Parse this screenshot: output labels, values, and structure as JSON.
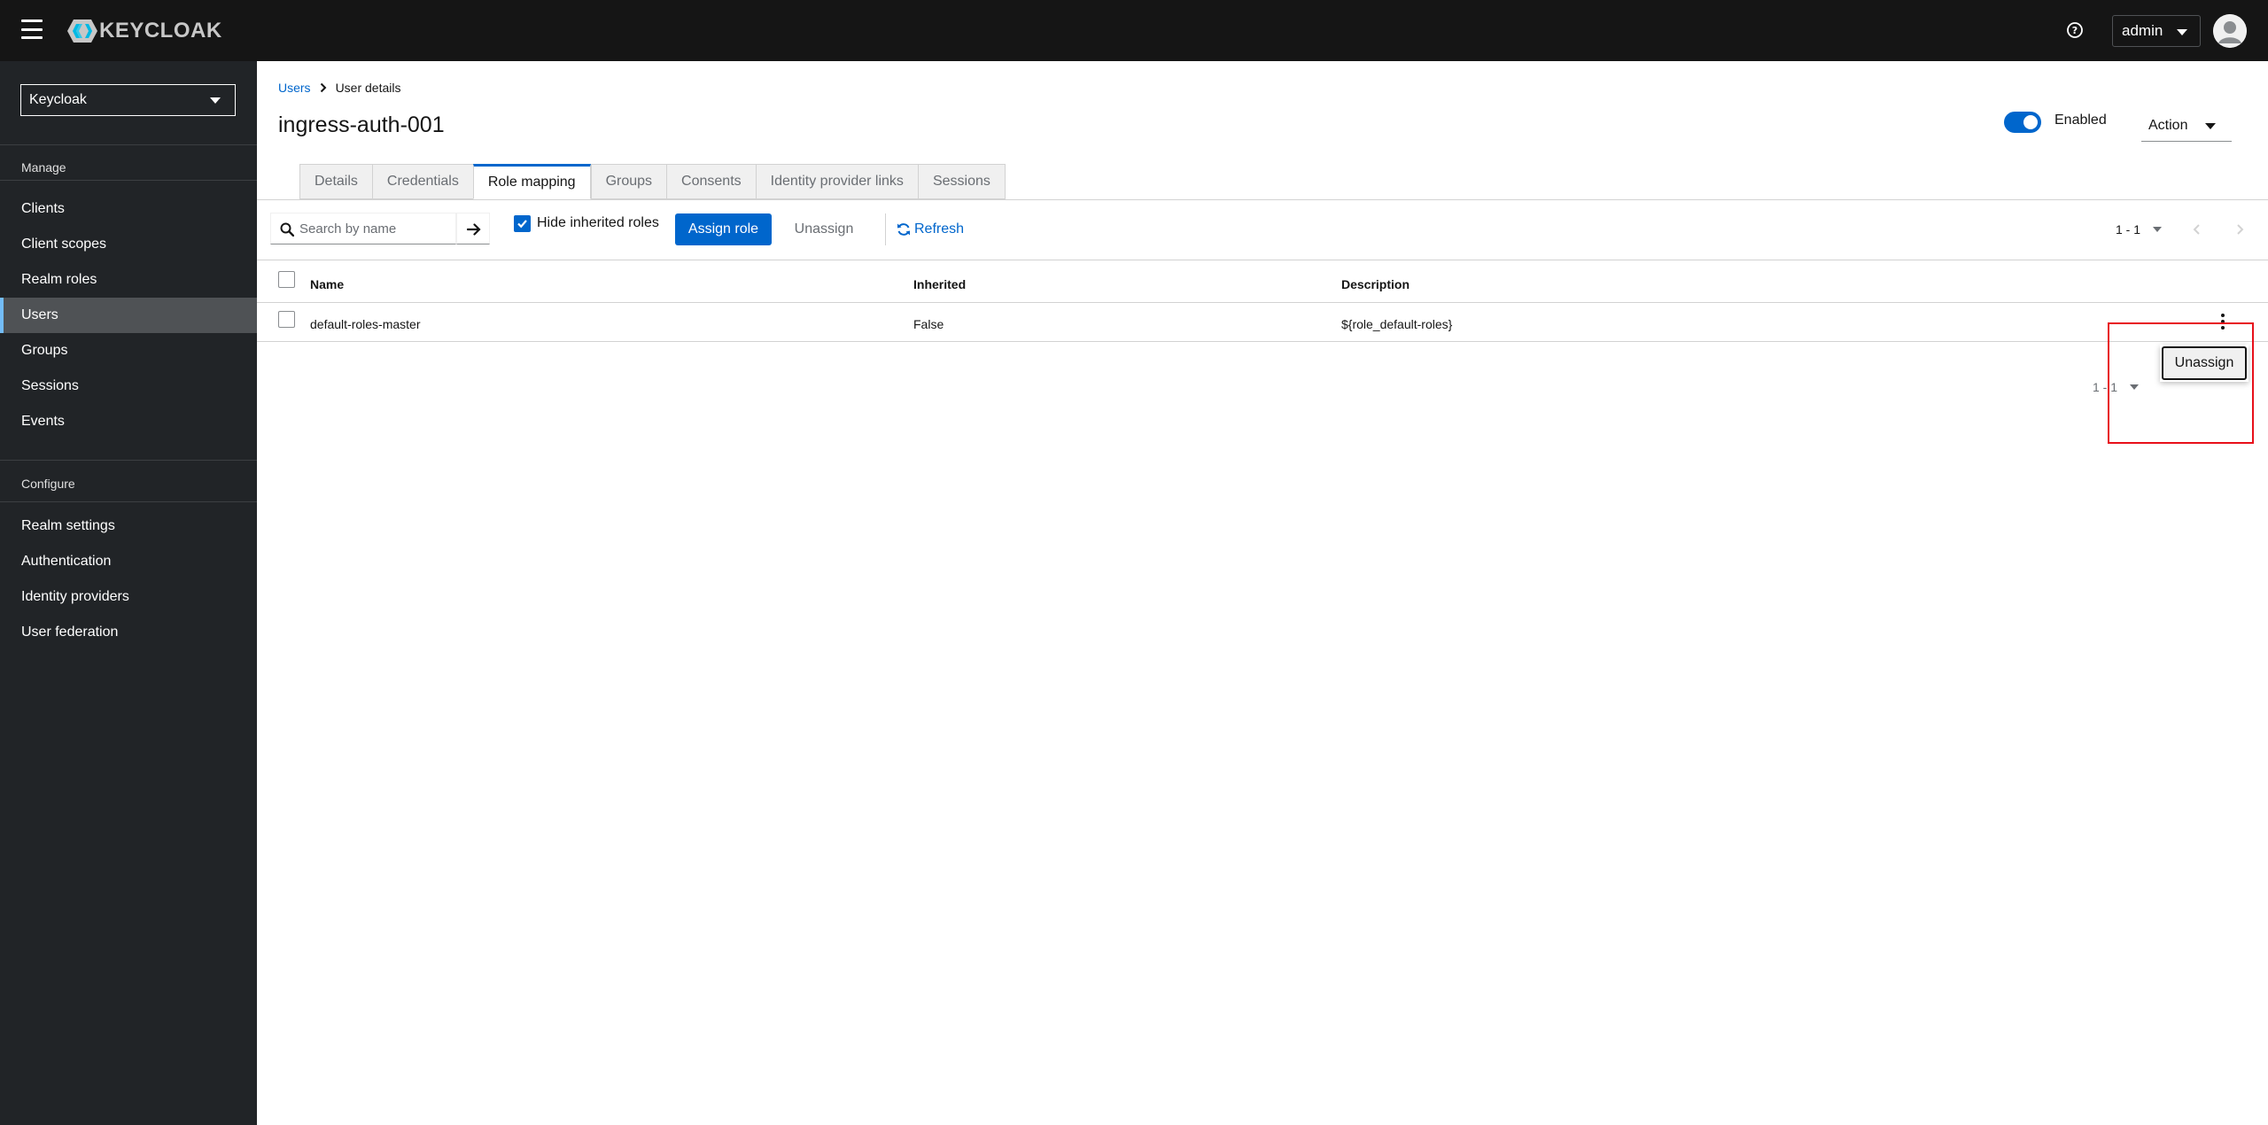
{
  "masthead": {
    "brand": "KEYCLOAK",
    "user": "admin",
    "icons": {
      "menu": "hamburger-icon",
      "help": "help-circle-icon",
      "avatar": "user-avatar"
    }
  },
  "sidebar": {
    "realm": "Keycloak",
    "manage_label": "Manage",
    "manage_items": [
      {
        "label": "Clients"
      },
      {
        "label": "Client scopes"
      },
      {
        "label": "Realm roles"
      },
      {
        "label": "Users",
        "active": true
      },
      {
        "label": "Groups"
      },
      {
        "label": "Sessions"
      },
      {
        "label": "Events"
      }
    ],
    "configure_label": "Configure",
    "configure_items": [
      {
        "label": "Realm settings"
      },
      {
        "label": "Authentication"
      },
      {
        "label": "Identity providers"
      },
      {
        "label": "User federation"
      }
    ]
  },
  "breadcrumb": {
    "parent": "Users",
    "current": "User details"
  },
  "page": {
    "title": "ingress-auth-001",
    "enabled_label": "Enabled",
    "enabled": true,
    "action_label": "Action"
  },
  "tabs": [
    {
      "label": "Details"
    },
    {
      "label": "Credentials"
    },
    {
      "label": "Role mapping",
      "active": true
    },
    {
      "label": "Groups"
    },
    {
      "label": "Consents"
    },
    {
      "label": "Identity provider links"
    },
    {
      "label": "Sessions"
    }
  ],
  "toolbar": {
    "search_placeholder": "Search by name",
    "hide_inherited_label": "Hide inherited roles",
    "hide_inherited_checked": true,
    "assign_label": "Assign role",
    "unassign_label": "Unassign",
    "refresh_label": "Refresh",
    "pagination": "1 - 1"
  },
  "table": {
    "columns": [
      "Name",
      "Inherited",
      "Description"
    ],
    "rows": [
      {
        "name": "default-roles-master",
        "inherited": "False",
        "description": "${role_default-roles}"
      }
    ]
  },
  "row_menu": {
    "items": [
      "Unassign"
    ]
  },
  "footer_pagination": "1 - 1",
  "colors": {
    "accent": "#0066cc",
    "masthead": "#151515",
    "sidebar": "#212427",
    "highlight": "#e8101a"
  }
}
